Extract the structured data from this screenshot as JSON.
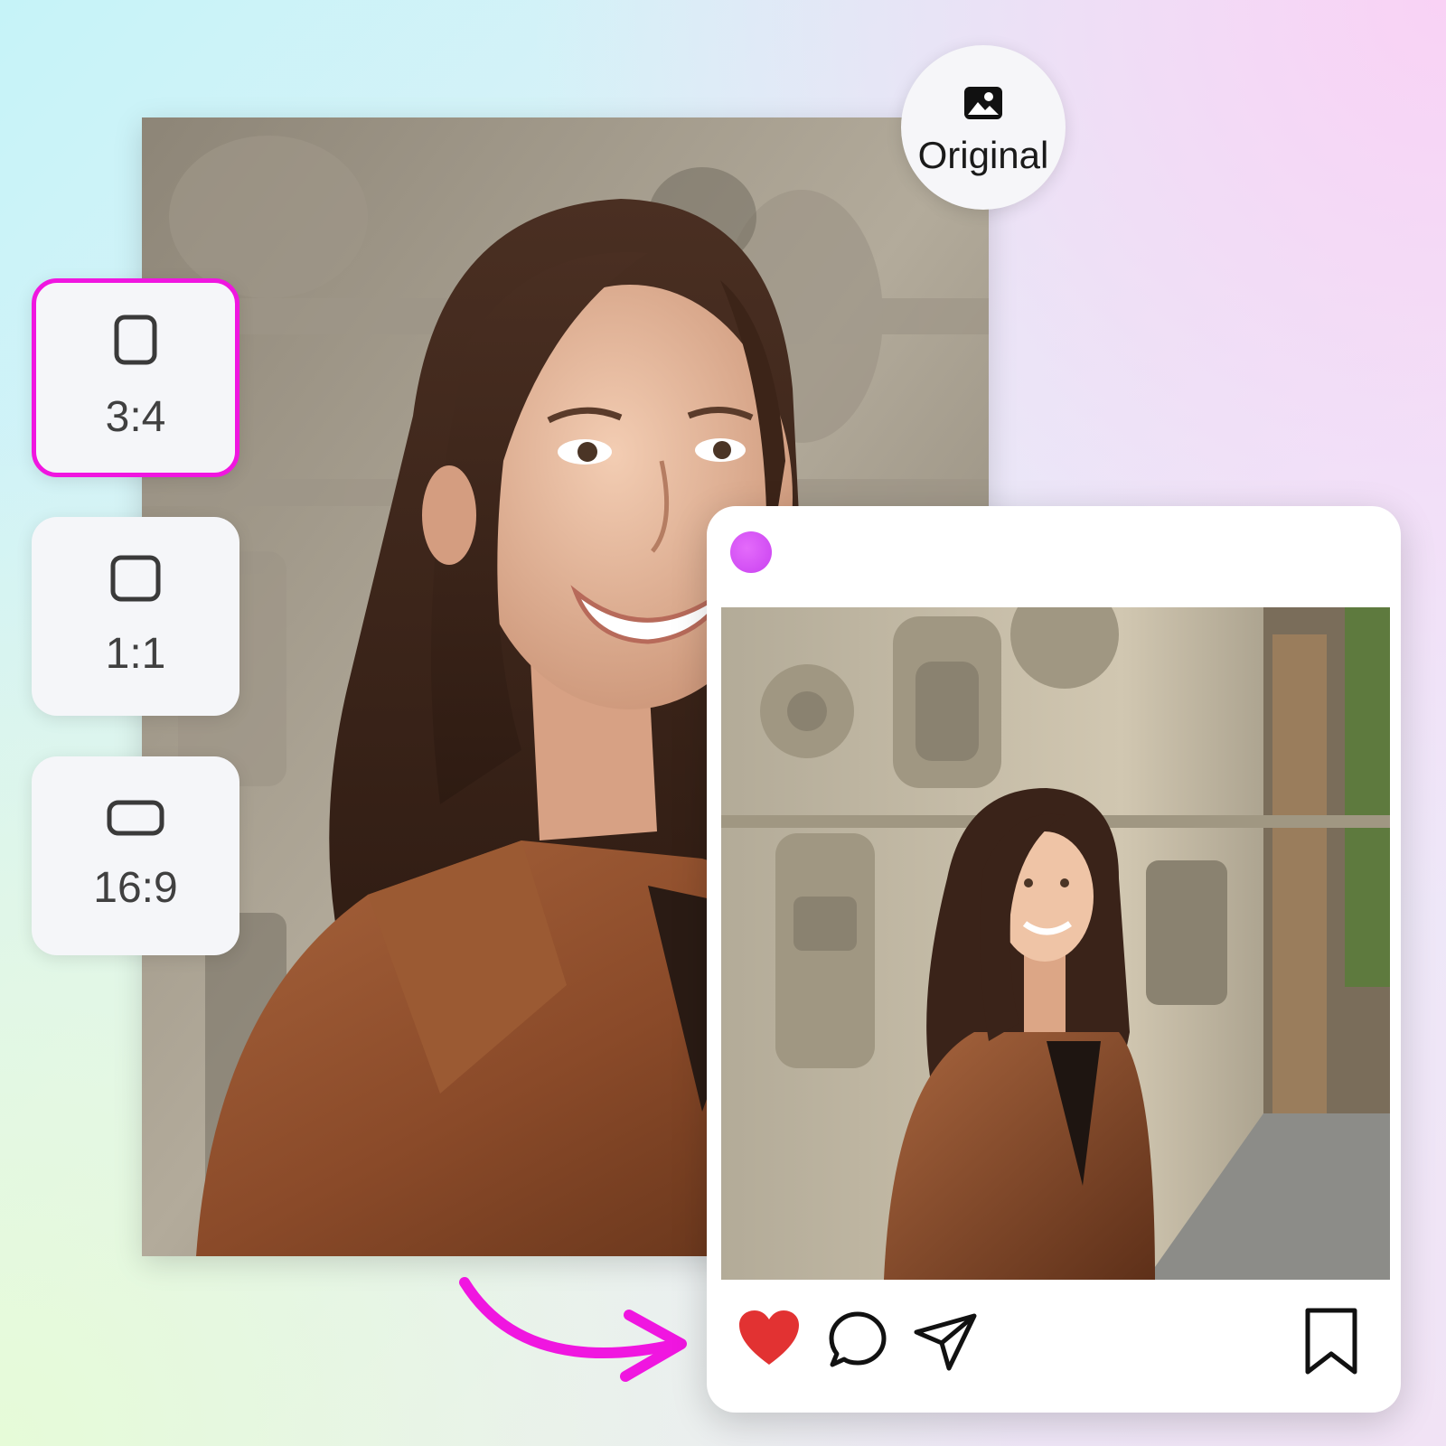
{
  "original_button": {
    "label": "Original",
    "icon": "image-icon"
  },
  "ratio_options": [
    {
      "label": "3:4",
      "icon": "portrait-frame-icon",
      "selected": true
    },
    {
      "label": "1:1",
      "icon": "square-frame-icon",
      "selected": false
    },
    {
      "label": "16:9",
      "icon": "landscape-frame-icon",
      "selected": false
    }
  ],
  "post": {
    "avatar_color": "#d555f5",
    "actions": [
      "heart-icon",
      "comment-icon",
      "share-icon",
      "bookmark-icon"
    ],
    "like_color": "#e23232"
  },
  "colors": {
    "accent": "#f016e0",
    "button_bg": "#f5f6f9"
  }
}
